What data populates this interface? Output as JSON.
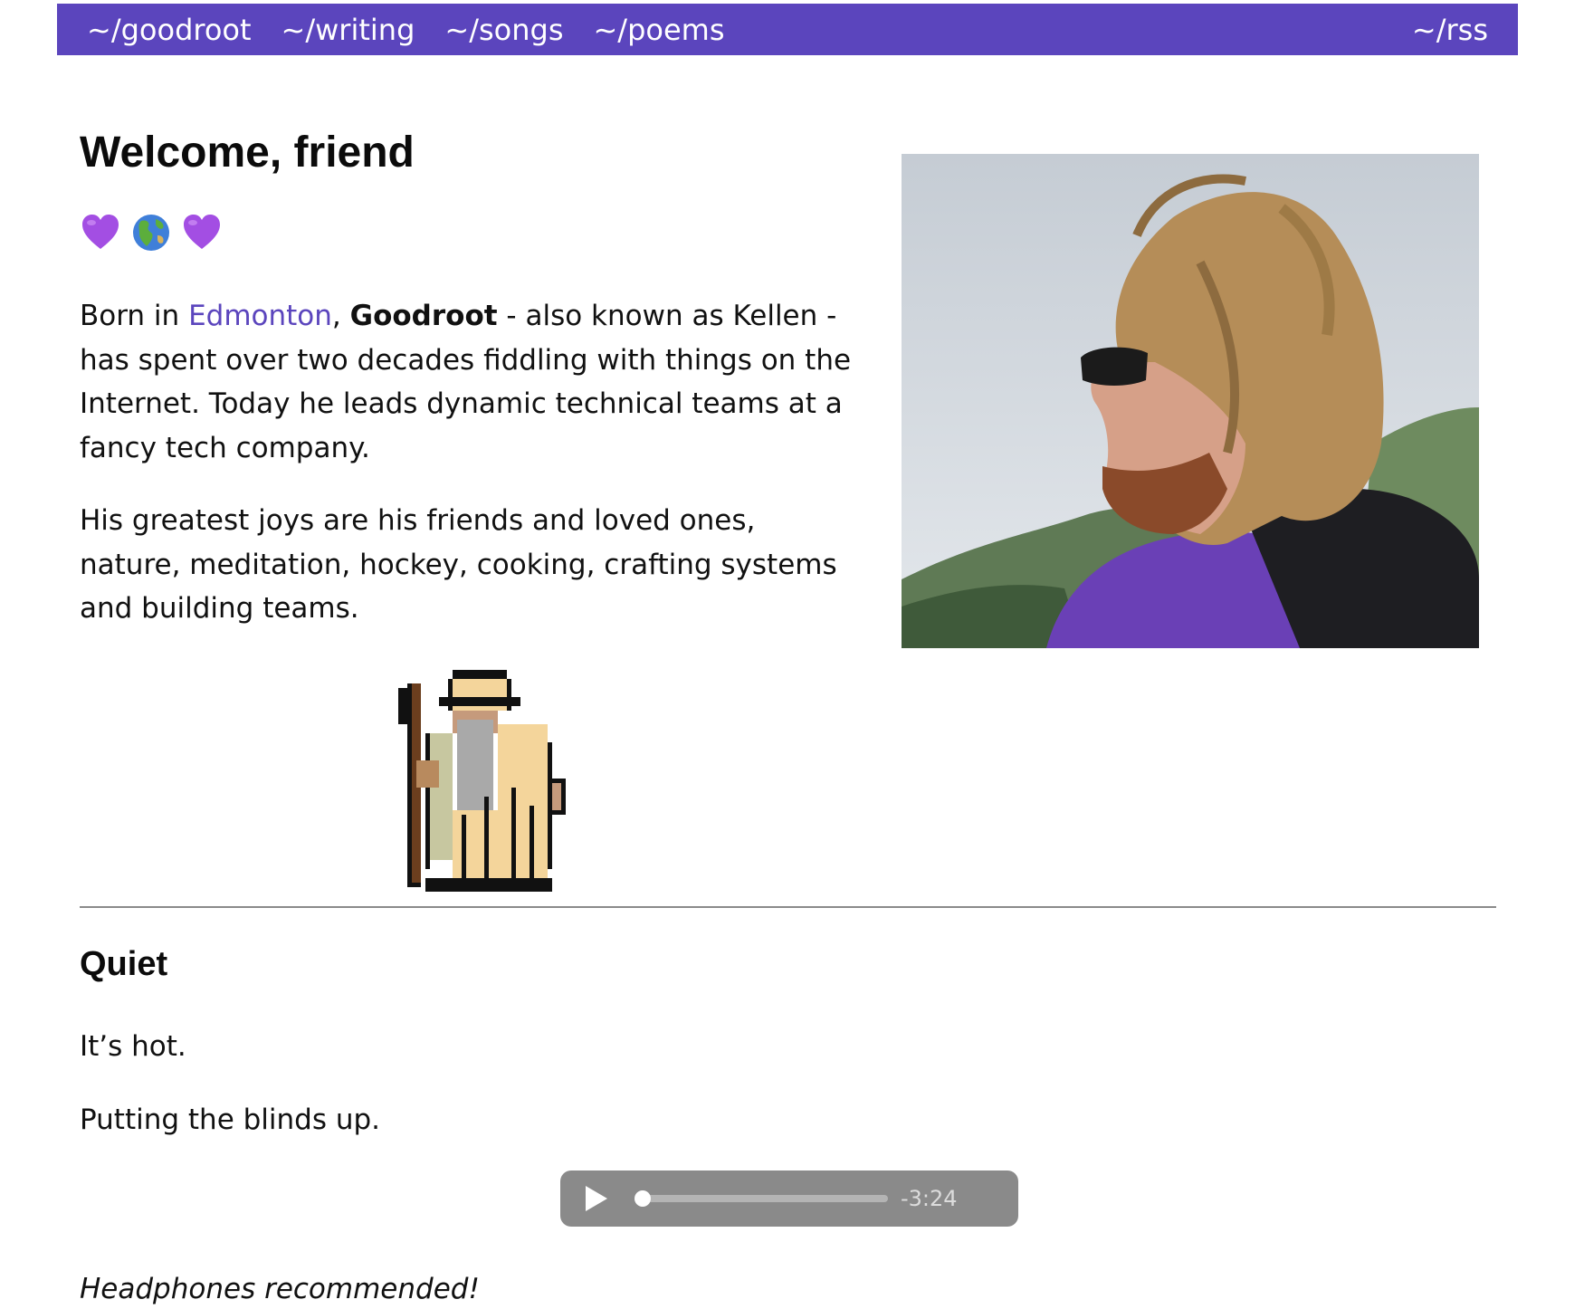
{
  "nav": {
    "links": [
      "~/goodroot",
      "~/writing",
      "~/songs",
      "~/poems"
    ],
    "rss": "~/rss"
  },
  "hero": {
    "title": "Welcome, friend",
    "emojis": [
      "purple-heart",
      "globe-americas",
      "purple-heart"
    ]
  },
  "bio": {
    "p1_prefix": "Born in ",
    "p1_link": "Edmonton",
    "p1_comma": ", ",
    "p1_name": "Goodroot",
    "p1_rest": " - also known as Kellen - has spent over two decades fiddling with things on the Internet. Today he leads dynamic technical teams at a fancy tech company.",
    "p2": "His greatest joys are his friends and loved ones, nature, meditation, hockey, cooking, crafting systems and building teams."
  },
  "post": {
    "title": "Quiet",
    "line1": "It’s hot.",
    "line2": "Putting the blinds up.",
    "note": "Headphones recommended!"
  },
  "audio": {
    "remaining": "-3:24",
    "progress": 0
  },
  "colors": {
    "accent": "#5b45bd",
    "player": "#8a8a8a"
  }
}
